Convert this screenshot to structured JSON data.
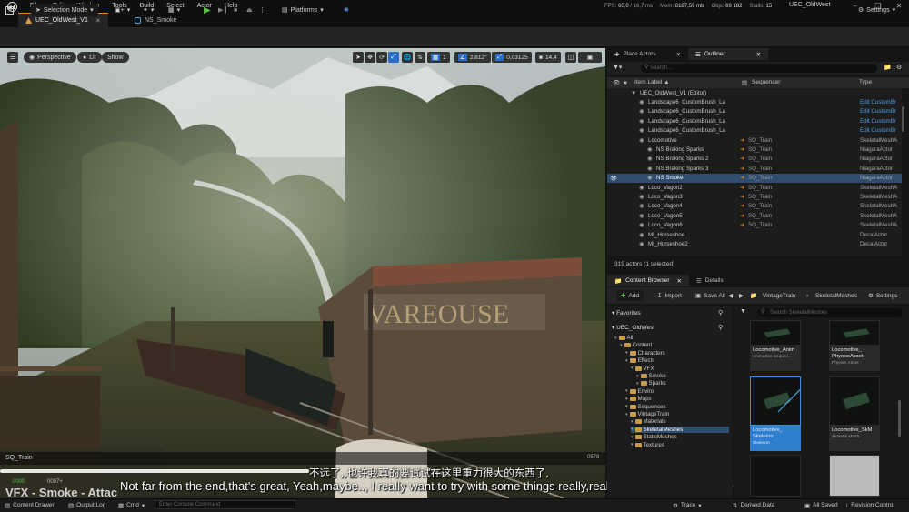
{
  "menu": {
    "items": [
      "File",
      "Edit",
      "Window",
      "Tools",
      "Build",
      "Select",
      "Actor",
      "Help"
    ]
  },
  "stats": {
    "fps_label": "FPS:",
    "fps": "60,0",
    "frame_time": "/ 16,7 ms",
    "mem_label": "Mem:",
    "mem": "8187,59 mb",
    "objs_label": "Objs:",
    "objs": "69 182",
    "stalls_label": "Stalls:",
    "stalls": "15"
  },
  "project_name": "UEC_OldWest",
  "tabs": [
    {
      "label": "UEC_OldWest_V1",
      "active": true
    },
    {
      "label": "NS_Smoke",
      "active": false
    }
  ],
  "toolbar": {
    "mode": "Selection Mode",
    "platforms": "Platforms",
    "settings": "Settings"
  },
  "viewport": {
    "perspective": "Perspective",
    "lit": "Lit",
    "show": "Show",
    "grid_value": "1",
    "angle_value": "2,812°",
    "scale_value": "0,03125",
    "camera_speed": "14,4",
    "sequence_name": "SQ_Train",
    "frame_end": "0578",
    "frame_start": "0000",
    "frame_cur": "0097+"
  },
  "subtitles": {
    "chinese": "不远了,,也许我真的要试试在这里重力很大的东西了,",
    "english": "Not far from the end,that's great, Yeah,maybe.., I really want to try with some things really,really big in the gravity here,"
  },
  "watermark": "VFX - Smoke - Attac",
  "outliner": {
    "tab_place": "Place Actors",
    "tab_outliner": "Outliner",
    "search_placeholder": "Search...",
    "col_label": "Item Label ▲",
    "col_sequencer": "Sequencer",
    "col_type": "Type",
    "rows": [
      {
        "label": "UEC_OldWest_V1 (Editor)",
        "seq": "",
        "type": "",
        "indent": 0,
        "sel": false,
        "link": false
      },
      {
        "label": "Landscape6_CustomBrush_La",
        "seq": "",
        "type": "Edit CustomBr",
        "indent": 1,
        "sel": false,
        "link": true
      },
      {
        "label": "Landscape6_CustomBrush_La",
        "seq": "",
        "type": "Edit CustomBr",
        "indent": 1,
        "sel": false,
        "link": true
      },
      {
        "label": "Landscape6_CustomBrush_La",
        "seq": "",
        "type": "Edit CustomBr",
        "indent": 1,
        "sel": false,
        "link": true
      },
      {
        "label": "Landscape6_CustomBrush_La",
        "seq": "",
        "type": "Edit CustomBr",
        "indent": 1,
        "sel": false,
        "link": true
      },
      {
        "label": "Locomotive",
        "seq": "SQ_Train",
        "type": "SkeletalMeshA",
        "indent": 1,
        "sel": false,
        "link": false
      },
      {
        "label": "NS Braking Sparks",
        "seq": "SQ_Train",
        "type": "NiagaraActor",
        "indent": 2,
        "sel": false,
        "link": false
      },
      {
        "label": "NS Braking Sparks 2",
        "seq": "SQ_Train",
        "type": "NiagaraActor",
        "indent": 2,
        "sel": false,
        "link": false
      },
      {
        "label": "NS Braking Sparks 3",
        "seq": "SQ_Train",
        "type": "NiagaraActor",
        "indent": 2,
        "sel": false,
        "link": false
      },
      {
        "label": "NS Smoke",
        "seq": "SQ_Train",
        "type": "NiagaraActor",
        "indent": 2,
        "sel": true,
        "link": false
      },
      {
        "label": "Loco_Vagon2",
        "seq": "SQ_Train",
        "type": "SkeletalMeshA",
        "indent": 1,
        "sel": false,
        "link": false
      },
      {
        "label": "Loco_Vagon3",
        "seq": "SQ_Train",
        "type": "SkeletalMeshA",
        "indent": 1,
        "sel": false,
        "link": false
      },
      {
        "label": "Loco_Vagon4",
        "seq": "SQ_Train",
        "type": "SkeletalMeshA",
        "indent": 1,
        "sel": false,
        "link": false
      },
      {
        "label": "Loco_Vagon5",
        "seq": "SQ_Train",
        "type": "SkeletalMeshA",
        "indent": 1,
        "sel": false,
        "link": false
      },
      {
        "label": "Loco_Vagon6",
        "seq": "SQ_Train",
        "type": "SkeletalMeshA",
        "indent": 1,
        "sel": false,
        "link": false
      },
      {
        "label": "MI_Horseshoe",
        "seq": "",
        "type": "DecalActor",
        "indent": 1,
        "sel": false,
        "link": false
      },
      {
        "label": "MI_Horseshoe2",
        "seq": "",
        "type": "DecalActor",
        "indent": 1,
        "sel": false,
        "link": false
      }
    ],
    "actor_count": "319 actors (1 selected)"
  },
  "content_browser": {
    "tab_cb": "Content Browser",
    "tab_details": "Details",
    "add": "Add",
    "import": "Import",
    "save_all": "Save All",
    "path": [
      "VintageTrain",
      "SkeletalMeshes"
    ],
    "settings": "Settings",
    "favorites": "Favorites",
    "root": "UEC_OldWest",
    "search_placeholder": "Search SkeletalMeshes",
    "tree": [
      {
        "label": "All",
        "indent": 0,
        "sel": false
      },
      {
        "label": "Content",
        "indent": 1,
        "sel": false
      },
      {
        "label": "Characters",
        "indent": 2,
        "sel": false
      },
      {
        "label": "Effects",
        "indent": 2,
        "sel": false
      },
      {
        "label": "VFX",
        "indent": 3,
        "sel": false
      },
      {
        "label": "Smoke",
        "indent": 4,
        "sel": false
      },
      {
        "label": "Sparks",
        "indent": 4,
        "sel": false
      },
      {
        "label": "Enviro",
        "indent": 2,
        "sel": false
      },
      {
        "label": "Maps",
        "indent": 2,
        "sel": false
      },
      {
        "label": "Sequences",
        "indent": 2,
        "sel": false
      },
      {
        "label": "VintageTrain",
        "indent": 2,
        "sel": false
      },
      {
        "label": "Materials",
        "indent": 3,
        "sel": false
      },
      {
        "label": "SkeletalMeshes",
        "indent": 3,
        "sel": true
      },
      {
        "label": "StaticMeshes",
        "indent": 3,
        "sel": false
      },
      {
        "label": "Textures",
        "indent": 3,
        "sel": false
      }
    ],
    "assets": [
      {
        "title": "Locomotive_Anim",
        "kind": "Animation Sequen...",
        "sel": false
      },
      {
        "title": "Locomotive_ PhysicsAsset",
        "kind": "Physics Asset",
        "sel": false
      },
      {
        "title": "Locomotive_ Skeleton",
        "kind": "Skeleton",
        "sel": true
      },
      {
        "title": "Locomotive_SkM",
        "kind": "Skeletal Mesh",
        "sel": false
      }
    ]
  },
  "statusbar": {
    "content_drawer": "Content Drawer",
    "output_log": "Output Log",
    "cmd": "Cmd",
    "console_placeholder": "Enter Console Command",
    "trace": "Trace",
    "derived_data": "Derived Data",
    "all_saved": "All Saved",
    "revision_control": "Revision Control"
  },
  "colors": {
    "accent_orange": "#e38a2a",
    "selection_blue": "#2f4d6f",
    "asset_selected": "#2f7fd1",
    "play_green": "#5fb84a",
    "link_blue": "#4d9be6"
  }
}
